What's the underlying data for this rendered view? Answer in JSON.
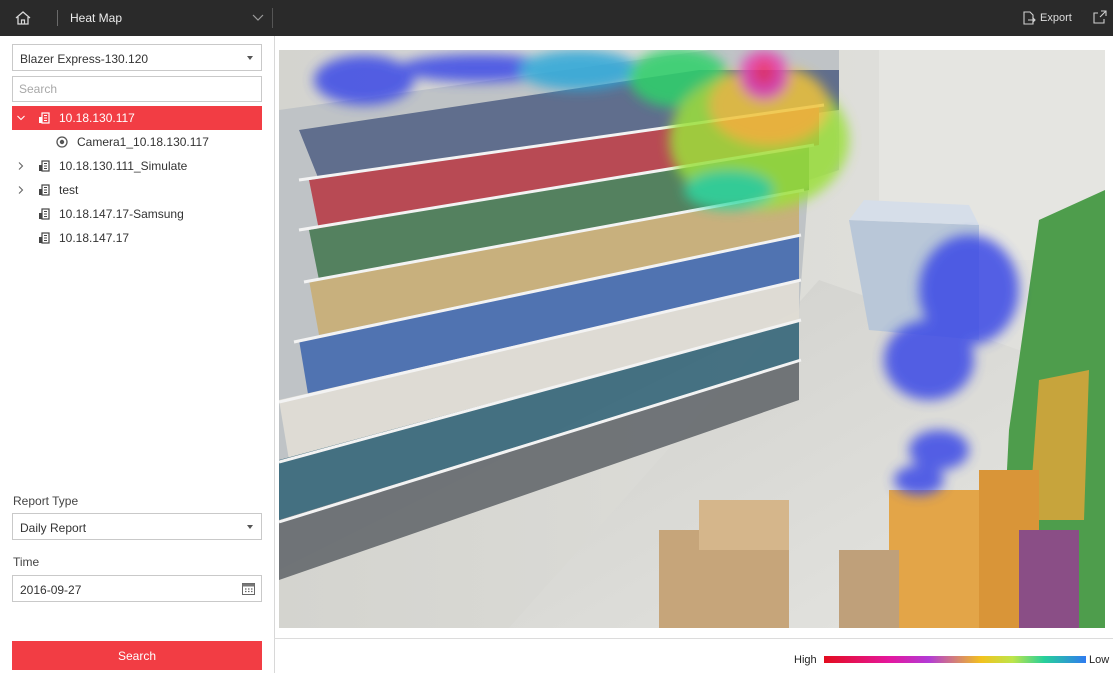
{
  "header": {
    "title": "Heat Map",
    "export_label": "Export"
  },
  "left_panel": {
    "device_select": "Blazer Express-130.120",
    "search_placeholder": "Search",
    "tree": [
      {
        "label": "10.18.130.117",
        "expanded": true,
        "selected": true
      },
      {
        "label": "Camera1_10.18.130.117",
        "child": true
      },
      {
        "label": "10.18.130.111_Simulate",
        "collapsed": true
      },
      {
        "label": "test",
        "collapsed": true
      },
      {
        "label": "10.18.147.17-Samsung"
      },
      {
        "label": "10.18.147.17"
      }
    ],
    "report_type_label": "Report Type",
    "report_type_value": "Daily Report",
    "time_label": "Time",
    "time_value": "2016-09-27",
    "search_button": "Search"
  },
  "legend": {
    "high": "High",
    "low": "Low"
  },
  "colors": {
    "accent": "#f23d44",
    "topbar": "#2a2a2a"
  }
}
